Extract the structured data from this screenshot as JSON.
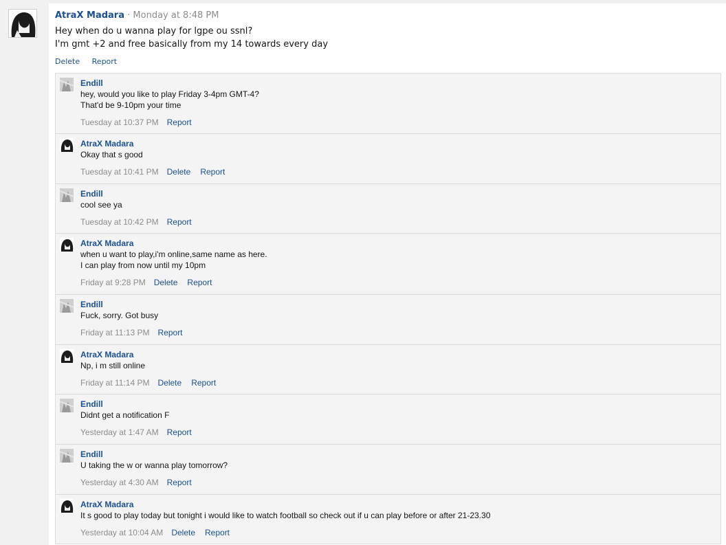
{
  "post": {
    "author": "AtraX Madara",
    "separator": "·",
    "timestamp": "Monday at 8:48 PM",
    "message": "Hey when do u wanna play for lgpe ou ssnl?\nI'm gmt +2 and free basically from my 14 towards every day",
    "actions": {
      "delete": "Delete",
      "report": "Report"
    }
  },
  "replies": [
    {
      "author": "Endill",
      "text": "hey, would you like to play Friday 3-4pm GMT-4?\nThat'd be 9-10pm your time",
      "timestamp": "Tuesday at 10:37 PM",
      "delete": "",
      "report": "Report",
      "avatar": "gray"
    },
    {
      "author": "AtraX Madara",
      "text": "Okay that s good",
      "timestamp": "Tuesday at 10:41 PM",
      "delete": "Delete",
      "report": "Report",
      "avatar": "anime"
    },
    {
      "author": "Endill",
      "text": "cool see ya",
      "timestamp": "Tuesday at 10:42 PM",
      "delete": "",
      "report": "Report",
      "avatar": "gray"
    },
    {
      "author": "AtraX Madara",
      "text": "when u want to play,i'm online,same name as here.\nI can play from now until my 10pm",
      "timestamp": "Friday at 9:28 PM",
      "delete": "Delete",
      "report": "Report",
      "avatar": "anime"
    },
    {
      "author": "Endill",
      "text": "Fuck, sorry. Got busy",
      "timestamp": "Friday at 11:13 PM",
      "delete": "",
      "report": "Report",
      "avatar": "gray"
    },
    {
      "author": "AtraX Madara",
      "text": "Np, i m still online",
      "timestamp": "Friday at 11:14 PM",
      "delete": "Delete",
      "report": "Report",
      "avatar": "anime"
    },
    {
      "author": "Endill",
      "text": "Didnt get a notification F",
      "timestamp": "Yesterday at 1:47 AM",
      "delete": "",
      "report": "Report",
      "avatar": "gray"
    },
    {
      "author": "Endill",
      "text": "U taking the w or wanna play tomorrow?",
      "timestamp": "Yesterday at 4:30 AM",
      "delete": "",
      "report": "Report",
      "avatar": "gray"
    },
    {
      "author": "AtraX Madara",
      "text": "It s good to play today but tonight i would like to watch football so check out if u can play before or after 21-23.30",
      "timestamp": "Yesterday at 10:04 AM",
      "delete": "Delete",
      "report": "Report",
      "avatar": "anime"
    }
  ],
  "colors": {
    "link": "#1a4f91",
    "muted": "#8c8c8c",
    "panel": "#f4f4f4"
  }
}
